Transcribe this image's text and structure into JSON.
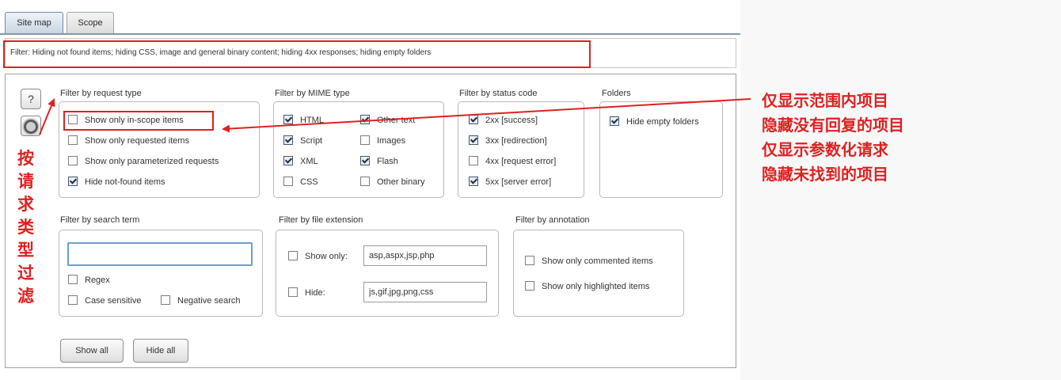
{
  "tabs": [
    {
      "label": "Site map",
      "active": true
    },
    {
      "label": "Scope",
      "active": false
    }
  ],
  "filter_bar": {
    "text": "Filter: Hiding not found items;  hiding CSS, image and general binary content;  hiding 4xx responses;  hiding empty folders"
  },
  "icons": {
    "help": "?",
    "settings": "gear-icon"
  },
  "request_type": {
    "title": "Filter by request type",
    "options": [
      {
        "label": "Show only in-scope items",
        "checked": false
      },
      {
        "label": "Show only requested items",
        "checked": false
      },
      {
        "label": "Show only parameterized requests",
        "checked": false
      },
      {
        "label": "Hide not-found items",
        "checked": true
      }
    ]
  },
  "mime_type": {
    "title": "Filter by MIME type",
    "options": [
      {
        "label": "HTML",
        "checked": true
      },
      {
        "label": "Other text",
        "checked": true
      },
      {
        "label": "Script",
        "checked": true
      },
      {
        "label": "Images",
        "checked": false
      },
      {
        "label": "XML",
        "checked": true
      },
      {
        "label": "Flash",
        "checked": true
      },
      {
        "label": "CSS",
        "checked": false
      },
      {
        "label": "Other binary",
        "checked": false
      }
    ]
  },
  "status_code": {
    "title": "Filter by status code",
    "options": [
      {
        "label": "2xx  [success]",
        "checked": true
      },
      {
        "label": "3xx  [redirection]",
        "checked": true
      },
      {
        "label": "4xx  [request error]",
        "checked": false
      },
      {
        "label": "5xx  [server error]",
        "checked": true
      }
    ]
  },
  "folders": {
    "title": "Folders",
    "options": [
      {
        "label": "Hide empty folders",
        "checked": true
      }
    ]
  },
  "search_term": {
    "title": "Filter by search term",
    "value": "",
    "regex": {
      "label": "Regex",
      "checked": false
    },
    "case_sensitive": {
      "label": "Case sensitive",
      "checked": false
    },
    "negative_search": {
      "label": "Negative search",
      "checked": false
    }
  },
  "file_extension": {
    "title": "Filter by file extension",
    "show_only": {
      "label": "Show only:",
      "checked": false,
      "value": "asp,aspx,jsp,php"
    },
    "hide": {
      "label": "Hide:",
      "checked": false,
      "value": "js,gif,jpg,png,css"
    }
  },
  "annotation_filter": {
    "title": "Filter by annotation",
    "options": [
      {
        "label": "Show only commented items",
        "checked": false
      },
      {
        "label": "Show only highlighted items",
        "checked": false
      }
    ]
  },
  "buttons": {
    "show_all": "Show all",
    "hide_all": "Hide all"
  },
  "annotations": {
    "vertical_label": [
      "按",
      "请",
      "求",
      "类",
      "型",
      "过",
      "滤"
    ],
    "lines": [
      "仅显示范围内项目",
      "隐藏没有回复的项目",
      "仅显示参数化请求",
      "隐藏未找到的项目"
    ]
  },
  "colors": {
    "annotation_red": "#e02020",
    "tab_line": "#8496ab",
    "search_focus": "#6a9cd2"
  }
}
